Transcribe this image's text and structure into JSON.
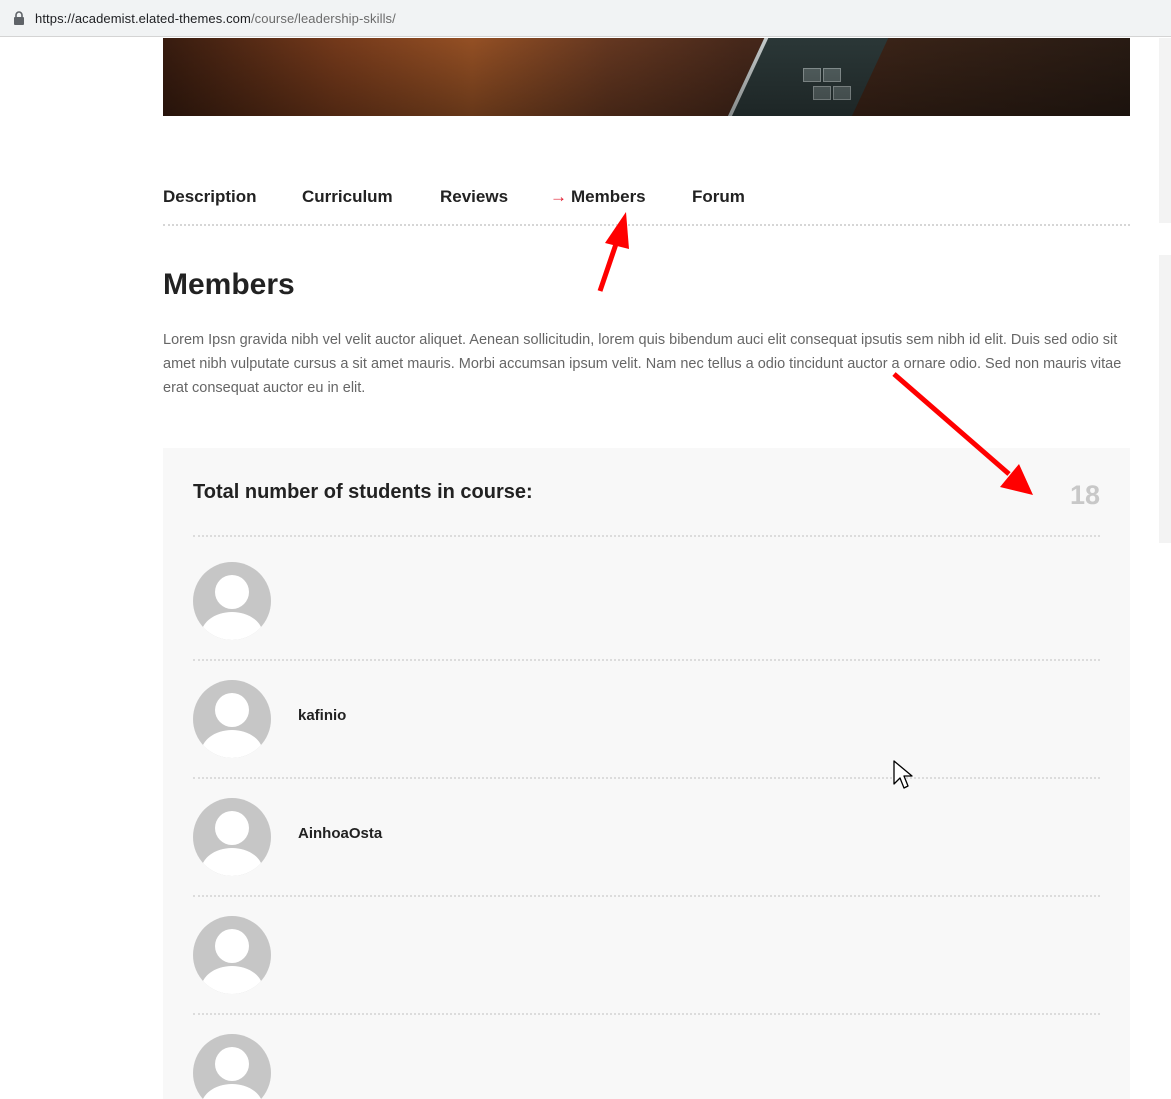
{
  "browser": {
    "url_host": "https://academist.elated-themes.com",
    "url_path": "/course/leadership-skills/"
  },
  "tabs": [
    {
      "label": "Description",
      "active": false
    },
    {
      "label": "Curriculum",
      "active": false
    },
    {
      "label": "Reviews",
      "active": false
    },
    {
      "label": "Members",
      "active": true,
      "marker": "→"
    },
    {
      "label": "Forum",
      "active": false
    }
  ],
  "section": {
    "title": "Members",
    "description": "Lorem Ipsn gravida nibh vel velit auctor aliquet. Aenean sollicitudin, lorem quis bibendum auci elit consequat ipsutis sem nibh id elit. Duis sed odio sit amet nibh vulputate cursus a sit amet mauris. Morbi accumsan ipsum velit. Nam nec tellus a odio tincidunt auctor a ornare odio. Sed non mauris vitae erat consequat auctor eu in elit."
  },
  "members_panel": {
    "total_label": "Total number of students in course:",
    "total_value": "18",
    "members": [
      {
        "name": ""
      },
      {
        "name": "kafinio"
      },
      {
        "name": "AinhoaOsta"
      },
      {
        "name": ""
      },
      {
        "name": ""
      }
    ]
  },
  "colors": {
    "accent": "#e01a2d",
    "annotation_arrow": "#ff0000",
    "panel_bg": "#f8f8f8",
    "count_color": "#c8c8c8",
    "avatar_bg": "#c6c6c6"
  },
  "icons": {
    "lock": "lock-icon",
    "avatar": "default-avatar-icon",
    "cursor": "mouse-cursor-icon",
    "annotation": "red-arrow-annotation"
  }
}
